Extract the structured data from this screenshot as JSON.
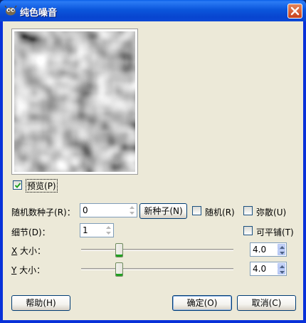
{
  "window": {
    "title": "纯色噪音"
  },
  "preview": {
    "label": "预览",
    "mnemonic": "(P)",
    "checked": true
  },
  "seed": {
    "label": "随机数种子",
    "mnemonic": "(R)",
    "colon": "：",
    "value": "0",
    "new_seed_label": "新种子",
    "new_seed_mnemonic": "(N)"
  },
  "random": {
    "label": "随机",
    "mnemonic": "(R)",
    "checked": false
  },
  "turbulent": {
    "label": "弥散",
    "mnemonic": "(U)",
    "checked": false
  },
  "detail": {
    "label": "细节",
    "mnemonic": "(D)",
    "colon": "：",
    "value": "1"
  },
  "tileable": {
    "label": "可平铺",
    "mnemonic": "(T)",
    "checked": false
  },
  "x_size": {
    "mnemonic": "X",
    "label": " 大小：",
    "value": "4.0",
    "level_fraction": 0.25
  },
  "y_size": {
    "mnemonic": "Y",
    "label": " 大小：",
    "value": "4.0",
    "level_fraction": 0.25
  },
  "buttons": {
    "help": {
      "label": "帮助",
      "mnemonic": "(H)"
    },
    "ok": {
      "label": "确定",
      "mnemonic": "(O)"
    },
    "cancel": {
      "label": "取消",
      "mnemonic": "(C)"
    }
  },
  "colors": {
    "titlebar": "#0b56dc",
    "dialog": "#ece9d8",
    "close": "#c8401a"
  }
}
